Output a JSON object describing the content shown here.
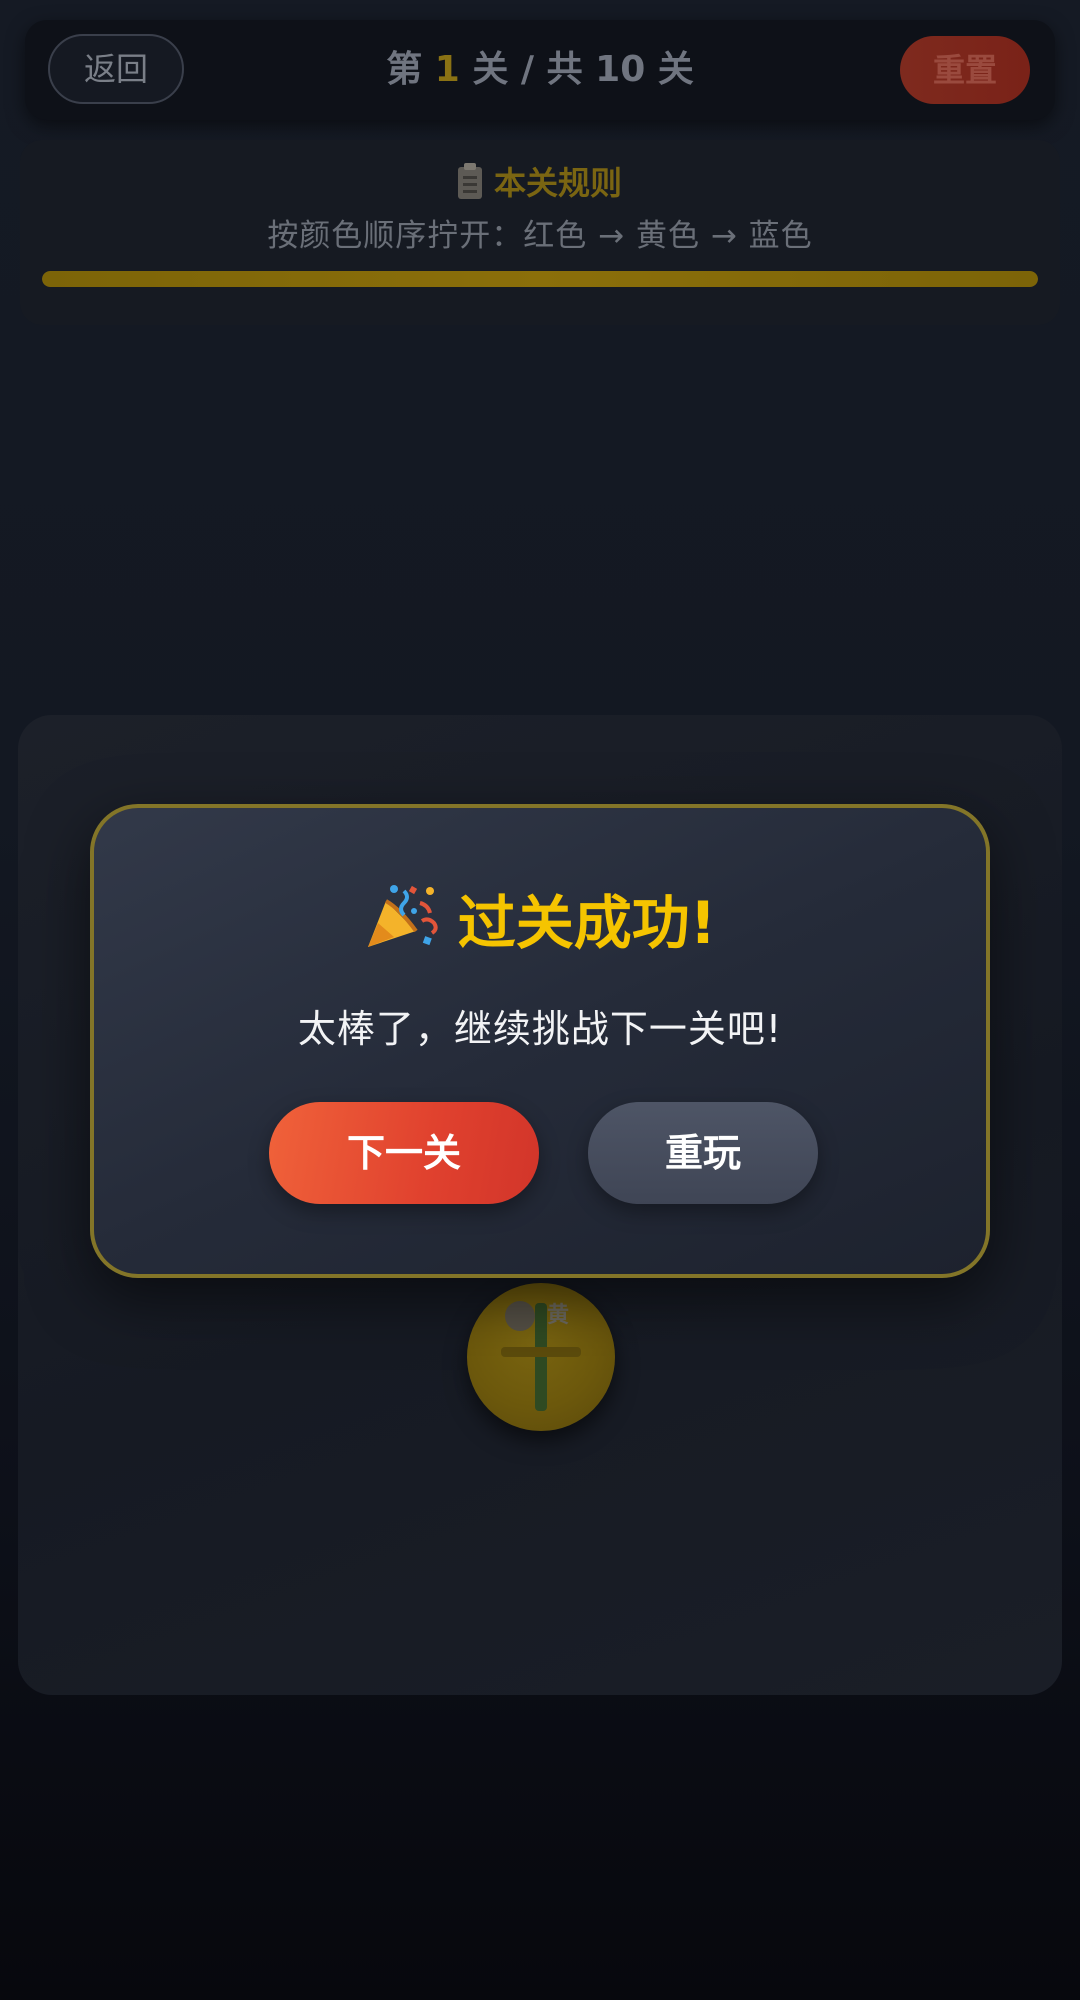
{
  "header": {
    "back_label": "返回",
    "level_prefix": "第",
    "current_level": "1",
    "level_suffix": "关 / 共 10 关",
    "reset_label": "重置"
  },
  "rules": {
    "title": "本关规则",
    "text": "按颜色顺序拧开：红色 → 黄色 → 蓝色",
    "progress_fraction": 1.0,
    "icon": "clipboard-icon"
  },
  "board": {
    "screw_label": "黄",
    "screw_color": "#6c580c"
  },
  "modal": {
    "title": "过关成功!",
    "icon": "party-popper-icon",
    "message": "太棒了，继续挑战下一关吧!",
    "next_label": "下一关",
    "replay_label": "重玩"
  },
  "colors": {
    "accent_gold": "#f5c400",
    "next_button": "#e0412e",
    "replay_button": "#4a5162",
    "modal_border": "#837528"
  }
}
